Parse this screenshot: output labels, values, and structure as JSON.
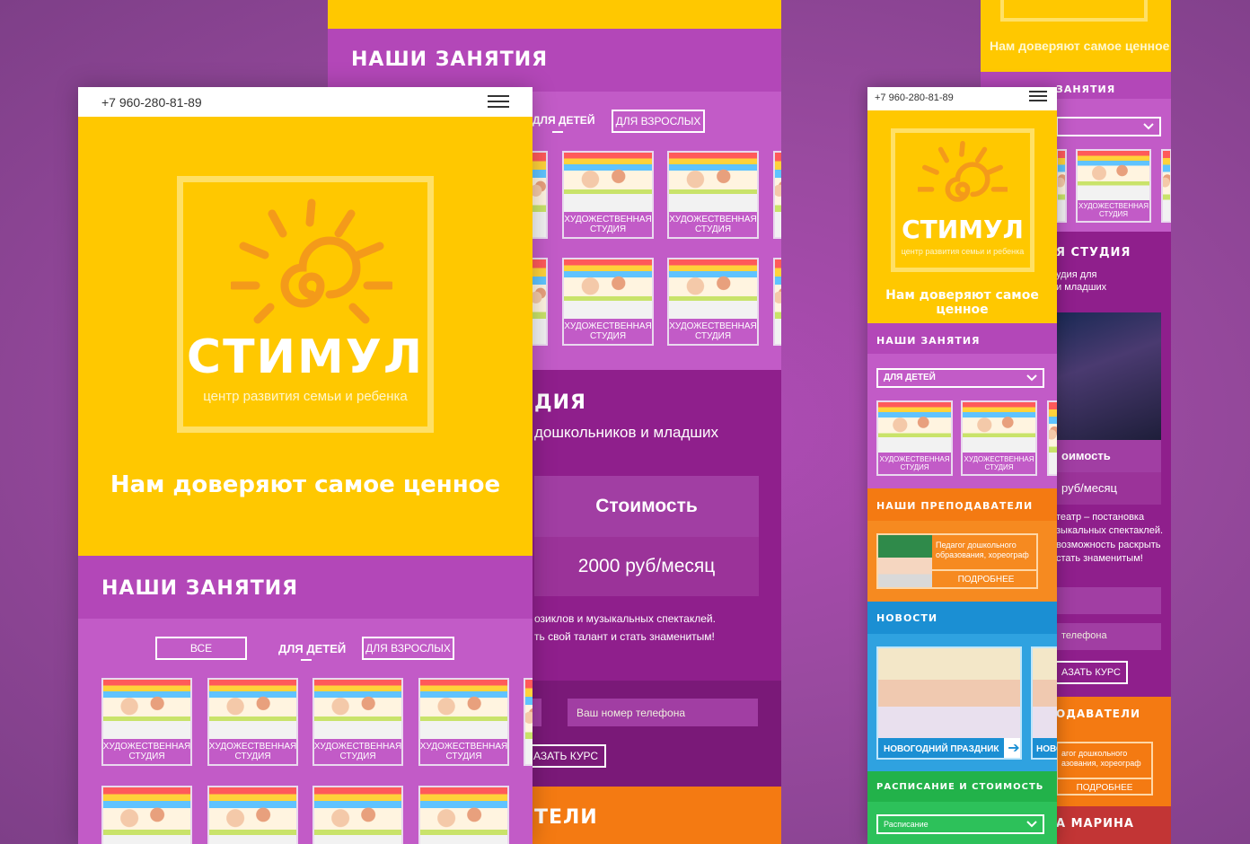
{
  "phone": "+7 960-280-81-89",
  "logo": {
    "name": "СТИМУЛ",
    "tagline": "центр развития семьи и ребенка"
  },
  "hero_slogan": "Нам доверяют самое ценное",
  "sections": {
    "classes": "НАШИ ЗАНЯТИЯ",
    "teachers": "НАШИ ПРЕПОДАВАТЕЛИ",
    "news": "НОВОСТИ",
    "schedule": "РАСПИСАНИЕ И СТОИМОСТЬ"
  },
  "filters": {
    "all": "ВСЕ",
    "kids": "ДЛЯ ДЕТЕЙ",
    "adults": "ДЛЯ ВЗРОСЛЫХ"
  },
  "course_card_label": "ХУДОЖЕСТВЕННАЯ СТУДИЯ",
  "studio": {
    "title_fragment": "ДИЯ",
    "title_fragment_right": "Я СТУДИЯ",
    "desc": "дошкольников и младших",
    "desc_right_1": "удия для",
    "desc_right_2": "и младших",
    "price_label": "Стоимость",
    "price": "2000 руб/месяц",
    "price_label_right": "оимость",
    "price_right": "руб/месяц",
    "text1": "озиклов и музыкальных спектаклей.",
    "text2": "ть свой талант и стать знаменитым!",
    "text_right_1": "театр – постановка",
    "text_right_2": "зыкальных спектаклей.",
    "text_right_3": "возможность раскрыть",
    "text_right_4": "стать знаменитым!"
  },
  "form": {
    "phone_placeholder": "Ваш номер телефона",
    "phone_placeholder_right": "телефона",
    "order_button": "АЗАТЬ КУРС",
    "order_button_right": "АЗАТЬ КУРС"
  },
  "teacher": {
    "desc": "Педагог дошкольного образования, хореограф",
    "desc_right": "агог дошкольного азования, хореограф",
    "more": "ПОДРОБНЕЕ",
    "name_fragment": "А МАРИНА"
  },
  "heading_fragments": {
    "teachers_left": "ТЕЛИ",
    "teachers_right": "ОДАВАТЕЛИ",
    "classes_right": "ЗАНЯТИЯ"
  },
  "news": {
    "item": "НОВОГОДНИЙ ПРАЗДНИК",
    "item_cut": "НОВО"
  },
  "schedule_select": "Расписание",
  "colors": {
    "yellow": "#ffc800",
    "purple": "#b347b8",
    "purple_light": "#c25bc7",
    "purple_dark": "#8f1f8c",
    "orange": "#f47a12",
    "blue": "#1b8fd3",
    "green": "#22b24a"
  }
}
